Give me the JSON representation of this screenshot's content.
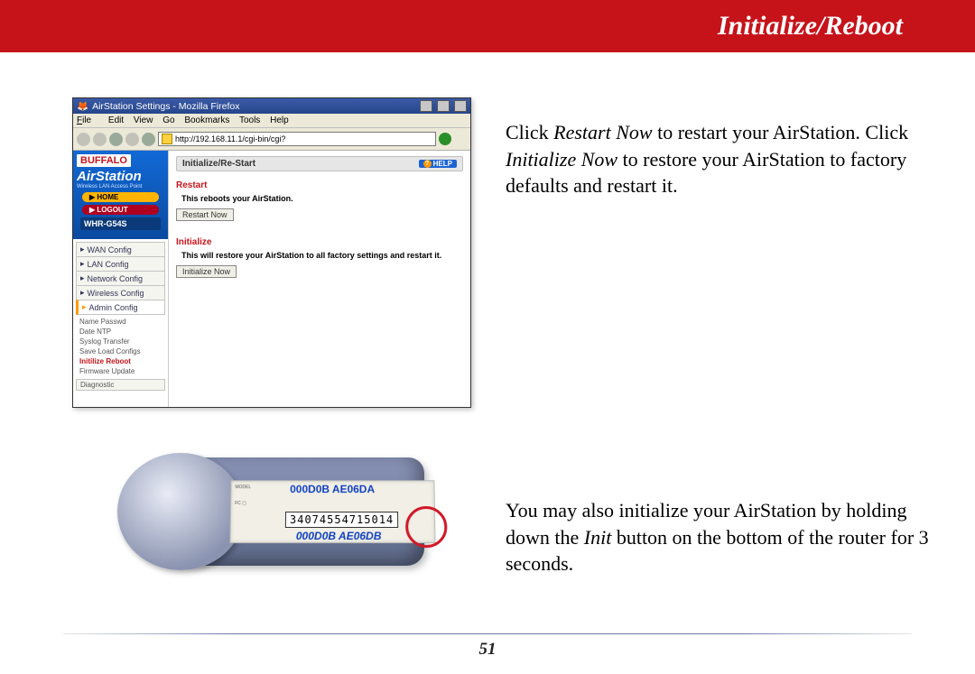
{
  "header": {
    "title": "Initialize/Reboot"
  },
  "page_number": "51",
  "instructions": {
    "p1_a": "Click ",
    "p1_restart": "Restart Now",
    "p1_b": " to restart your AirStation.  Click ",
    "p1_init": "Initialize Now",
    "p1_c": " to restore your AirStation to factory defaults and restart it.",
    "p2_a": "You may also initialize your AirStation by holding down the ",
    "p2_init": "Init",
    "p2_b": " button on the bottom of the router for 3 seconds."
  },
  "screenshot": {
    "window_title": "AirStation Settings - Mozilla Firefox",
    "menubar": {
      "file": "File",
      "edit": "Edit",
      "view": "View",
      "go": "Go",
      "bookmarks": "Bookmarks",
      "tools": "Tools",
      "help": "Help"
    },
    "url": "http://192.168.11.1/cgi-bin/cgi?",
    "brand": {
      "buffalo": "BUFFALO",
      "airstation": "AirStation",
      "sub": "Wireless LAN Access Point"
    },
    "pill_home": "HOME",
    "pill_logout": "LOGOUT",
    "model": "WHR-G54S",
    "nav": {
      "wan": "WAN Config",
      "lan": "LAN Config",
      "network": "Network Config",
      "wireless": "Wireless Config",
      "admin": "Admin Config"
    },
    "subnav": {
      "name": "Name Passwd",
      "date": "Date NTP",
      "syslog": "Syslog Transfer",
      "saveload": "Save Load Configs",
      "initreboot": "Initilize Reboot",
      "firmware": "Firmware Update",
      "diag": "Diagnostic"
    },
    "tab_label": "Initialize/Re-Start",
    "help": "HELP",
    "restart_heading": "Restart",
    "restart_desc": "This reboots your AirStation.",
    "restart_btn": "Restart Now",
    "init_heading": "Initialize",
    "init_desc": "This will restore your AirStation to all factory settings and restart it.",
    "init_btn": "Initialize Now"
  },
  "router": {
    "mac1": "000D0B AE06DA",
    "serial": "34074554715014",
    "mac2": "000D0B AE06DB"
  }
}
